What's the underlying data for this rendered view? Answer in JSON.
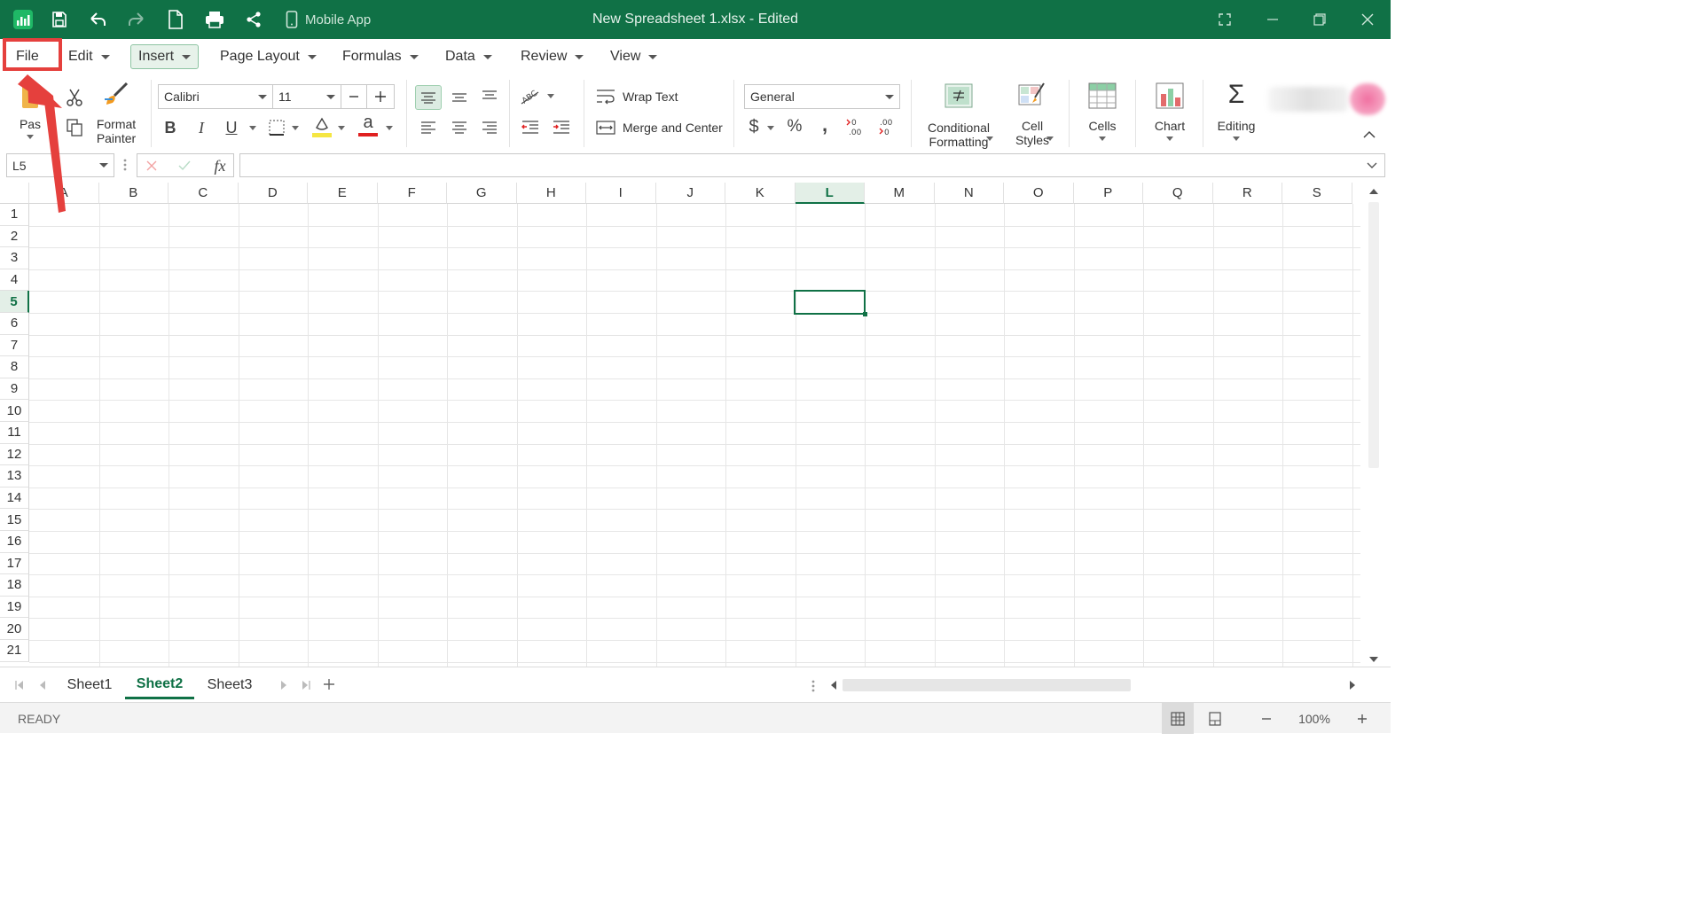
{
  "window": {
    "title": "New Spreadsheet 1.xlsx - Edited",
    "mobile_app_label": "Mobile App",
    "accent_color": "#107146"
  },
  "menu": {
    "items": [
      {
        "label": "File",
        "caret": false
      },
      {
        "label": "Edit",
        "caret": true
      },
      {
        "label": "Insert",
        "caret": true
      },
      {
        "label": "Page Layout",
        "caret": true
      },
      {
        "label": "Formulas",
        "caret": true
      },
      {
        "label": "Data",
        "caret": true
      },
      {
        "label": "Review",
        "caret": true
      },
      {
        "label": "View",
        "caret": true
      }
    ],
    "highlighted": "File",
    "active": "Insert"
  },
  "ribbon": {
    "paste_label": "Pas",
    "format_painter_label": "Format\nPainter",
    "font_name": "Calibri",
    "font_size": "11",
    "wrap_text_label": "Wrap Text",
    "merge_center_label": "Merge and Center",
    "number_format": "General",
    "conditional_formatting_label": "Conditional\nFormatting",
    "cell_styles_label": "Cell\nStyles",
    "cells_label": "Cells",
    "chart_label": "Chart",
    "editing_label": "Editing",
    "bold_glyph": "B",
    "italic_glyph": "I",
    "underline_glyph": "U",
    "font_color_glyph": "a",
    "currency_glyph": "$",
    "percent_glyph": "%",
    "comma_glyph": ",",
    "sigma_glyph": "Σ",
    "fill_color": "#f5e642",
    "font_color": "#e02020"
  },
  "formula_bar": {
    "name_box": "L5",
    "fx_label": "fx",
    "formula": ""
  },
  "grid": {
    "columns": [
      "A",
      "B",
      "C",
      "D",
      "E",
      "F",
      "G",
      "H",
      "I",
      "J",
      "K",
      "L",
      "M",
      "N",
      "O",
      "P",
      "Q",
      "R",
      "S"
    ],
    "rows": [
      "1",
      "2",
      "3",
      "4",
      "5",
      "6",
      "7",
      "8",
      "9",
      "10",
      "11",
      "12",
      "13",
      "14",
      "15",
      "16",
      "17",
      "18",
      "19",
      "20",
      "21"
    ],
    "active_column": "L",
    "active_row": "5"
  },
  "sheets": {
    "tabs": [
      "Sheet1",
      "Sheet2",
      "Sheet3"
    ],
    "active": "Sheet2"
  },
  "status": {
    "text": "READY",
    "zoom": "100%"
  }
}
